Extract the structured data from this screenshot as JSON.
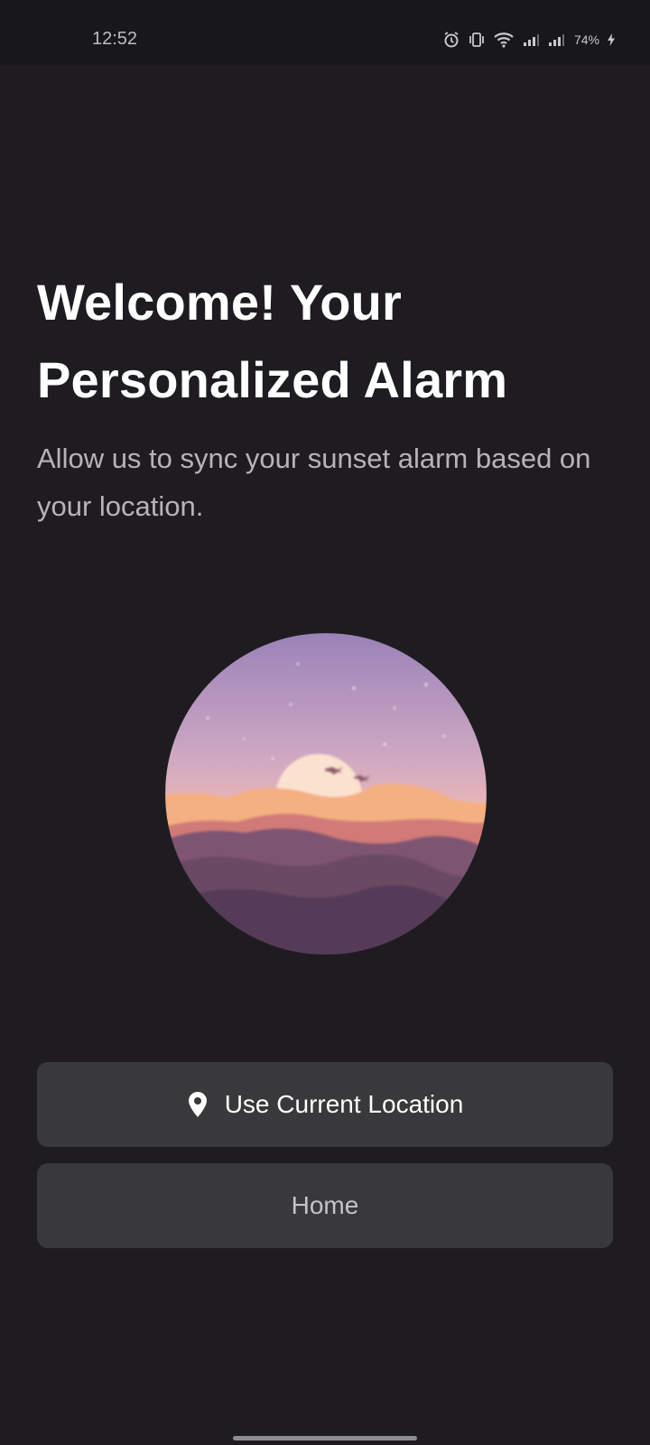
{
  "status_bar": {
    "time": "12:52",
    "battery": "74%",
    "icons": [
      "alarm-icon",
      "vibrate-icon",
      "wifi-icon",
      "signal-icon",
      "signal-icon",
      "charging-icon"
    ]
  },
  "onboarding": {
    "title": "Welcome! Your Personalized Alarm",
    "subtitle": "Allow us to sync your sunset alarm based on your location."
  },
  "buttons": {
    "use_location_label": "Use Current Location",
    "use_location_icon": "location-pin-icon",
    "home_label": "Home"
  },
  "colors": {
    "background": "#1e1c21",
    "button_bg": "#39383a",
    "title": "#ffffff",
    "subtitle": "#b6b4b9"
  }
}
